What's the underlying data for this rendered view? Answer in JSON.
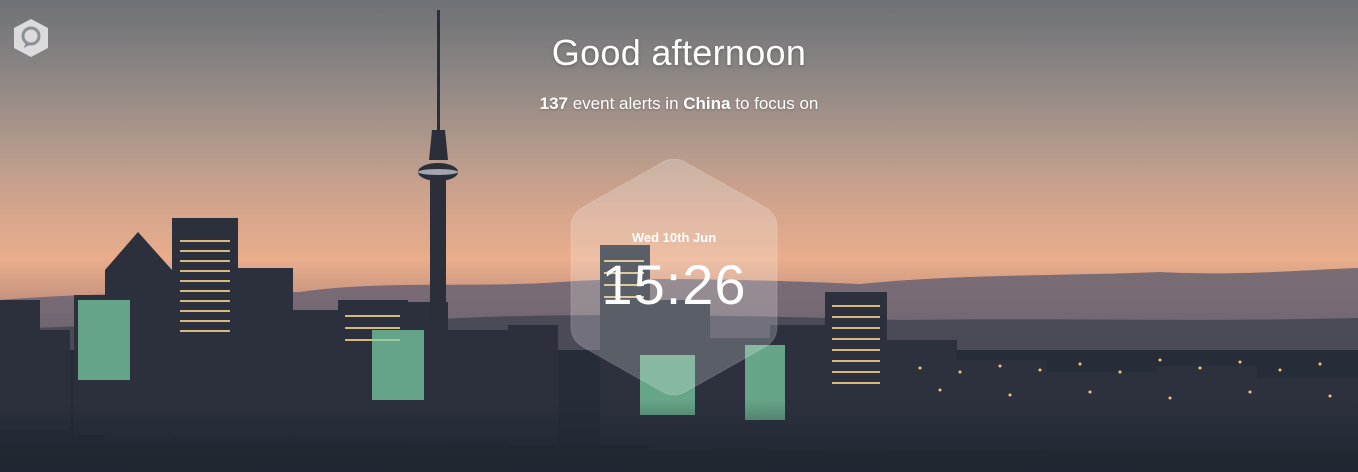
{
  "header": {
    "greeting": "Good afternoon",
    "alert_count": "137",
    "alert_text_1": " event alerts in ",
    "alert_location": "China",
    "alert_text_2": " to focus on"
  },
  "clock": {
    "date": "Wed 10th Jun",
    "time": "15:26"
  },
  "logo": {
    "icon": "location-pin-logo-icon"
  },
  "colors": {
    "text": "#ffffff",
    "sky_top": "#6e7176",
    "sky_glow": "#e9ad8b",
    "city_dark": "#1f2630"
  }
}
